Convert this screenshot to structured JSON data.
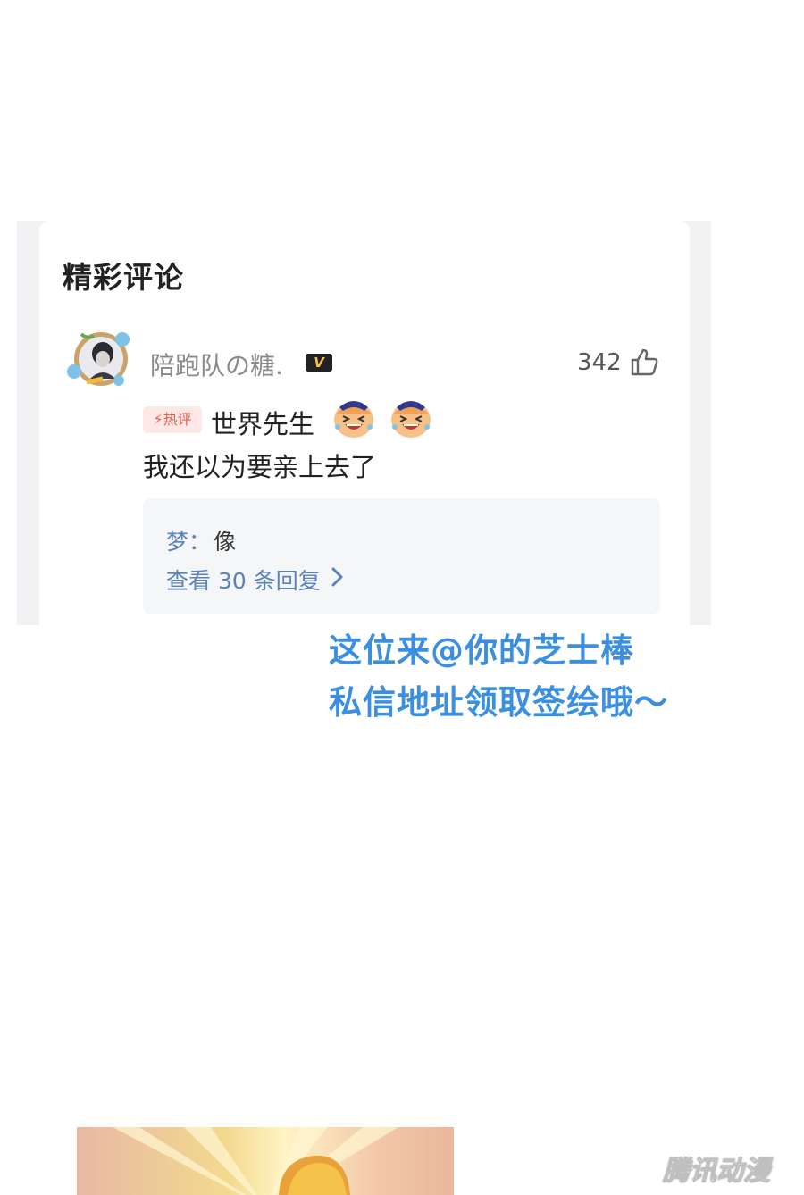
{
  "section_title": "精彩评论",
  "comment": {
    "username": "陪跑队の糖.",
    "vip_badge": "V",
    "like_count": "342",
    "hot_badge": "热评",
    "line1": "世界先生",
    "line2": "我还以为要亲上去了",
    "emojis": [
      "laughing-face-emoji",
      "laughing-face-emoji"
    ]
  },
  "reply": {
    "author": "梦：",
    "text": "像",
    "view_more": "查看 30 条回复"
  },
  "caption": {
    "line1": "这位来@你的芝士棒",
    "line2": "私信地址领取签绘哦～"
  },
  "watermark": "腾讯动漫",
  "colors": {
    "accent_blue": "#3b8fe0",
    "link_blue": "#5b82b8",
    "hot_red": "#ee5a4a"
  }
}
